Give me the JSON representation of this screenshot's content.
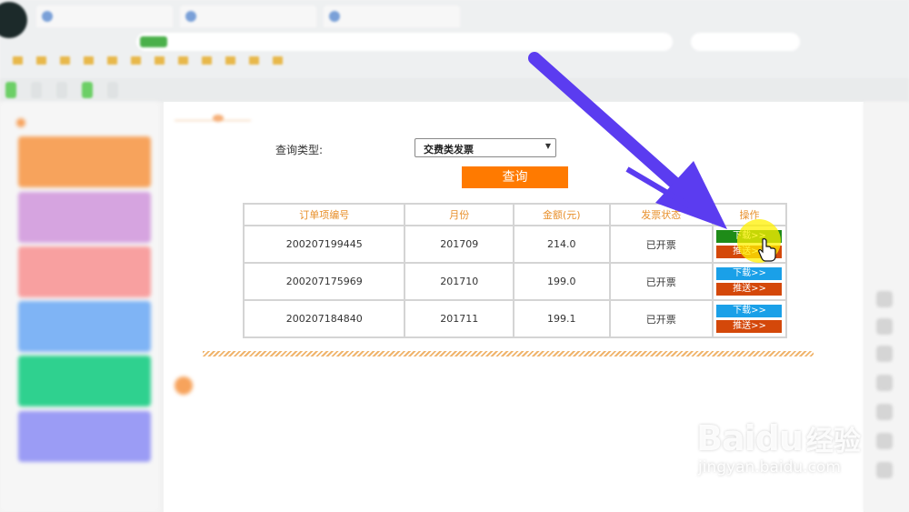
{
  "browser": {
    "tabs": [
      {
        "title": ""
      },
      {
        "title": ""
      },
      {
        "title": ""
      }
    ],
    "address_url": "",
    "search_placeholder": "",
    "bookmarks": [
      "",
      "",
      "",
      "",
      "",
      "",
      "",
      "",
      "",
      "",
      "",
      "",
      "",
      ""
    ],
    "site_nav": [
      "",
      "",
      "",
      "",
      ""
    ]
  },
  "sidebar": {
    "heading": "",
    "cards": [
      {
        "title": "",
        "subtitle": "",
        "color": "#f7a35c"
      },
      {
        "title": "",
        "subtitle": "",
        "color": "#d6a4e0"
      },
      {
        "title": "",
        "subtitle": "",
        "color": "#f8a0a0"
      },
      {
        "title": "",
        "subtitle": "",
        "color": "#7fb4f5"
      },
      {
        "title": "",
        "subtitle": "",
        "color": "#2fd18f"
      },
      {
        "title": "",
        "subtitle": "",
        "color": "#9b9cf5"
      }
    ],
    "footer": ""
  },
  "query": {
    "label": "查询类型:",
    "type_selected": "交费类发票",
    "button": "查询"
  },
  "table": {
    "headers": [
      "订单项编号",
      "月份",
      "金额(元)",
      "发票状态",
      "操作"
    ],
    "rows": [
      {
        "order_id": "200207199445",
        "month": "201709",
        "amount": "214.0",
        "status": "已开票",
        "download": "下载>>",
        "push": "推送>>"
      },
      {
        "order_id": "200207175969",
        "month": "201710",
        "amount": "199.0",
        "status": "已开票",
        "download": "下载>>",
        "push": "推送>>"
      },
      {
        "order_id": "200207184840",
        "month": "201711",
        "amount": "199.1",
        "status": "已开票",
        "download": "下载>>",
        "push": "推送>>"
      }
    ]
  },
  "lower": {
    "section_title": "",
    "paragraphs": [
      "",
      "",
      "",
      ""
    ]
  },
  "watermark": {
    "brand": "Baidu",
    "cn": "经验",
    "url": "jingyan.baidu.com"
  },
  "colors": {
    "accent_orange": "#ff7a00",
    "header_orange": "#e8902c",
    "download_blue": "#1aa0e8",
    "download_hover_green": "#1e8b18",
    "push_red": "#d4480a",
    "arrow_purple": "#5b3cf0",
    "highlight_yellow": "#fff000"
  },
  "icons": {
    "cursor": "hand-pointer-icon",
    "annotation": "arrow-icon",
    "select_caret": "triangle-down-icon"
  }
}
